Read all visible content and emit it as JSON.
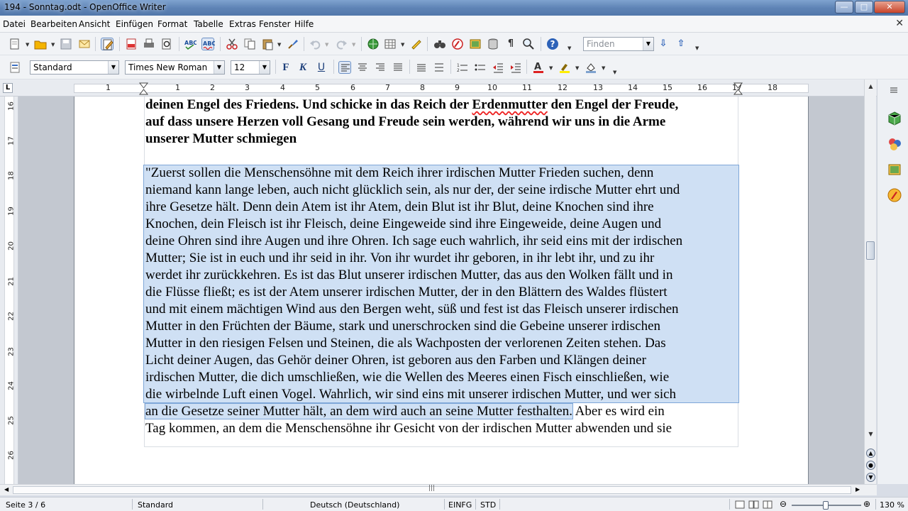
{
  "window": {
    "title": "194 - Sonntag.odt - OpenOffice Writer",
    "minimize_glyph": "—",
    "maximize_glyph": "□",
    "close_glyph": "✕"
  },
  "menubar": {
    "items": [
      "Datei",
      "Bearbeiten",
      "Ansicht",
      "Einfügen",
      "Format",
      "Tabelle",
      "Extras",
      "Fenster",
      "Hilfe"
    ],
    "doc_close": "✕"
  },
  "formatting": {
    "paragraph_style": "Standard",
    "font_name": "Times New Roman",
    "font_size": "12",
    "find_placeholder": "Finden",
    "bold": "F",
    "italic": "K",
    "underline": "U"
  },
  "ruler": {
    "corner": "L",
    "h_numbers": [
      "1",
      "1",
      "2",
      "3",
      "4",
      "5",
      "6",
      "7",
      "8",
      "9",
      "10",
      "11",
      "12",
      "13",
      "14",
      "15",
      "16",
      "17",
      "18"
    ],
    "v_numbers": [
      "16",
      "17",
      "18",
      "19",
      "20",
      "21",
      "22",
      "23",
      "24",
      "25",
      "26"
    ]
  },
  "document": {
    "heading_lines": [
      [
        "deinen Engel des Friedens. Und schicke in das Reich der ",
        "Erdenmutter",
        " den Engel der Freude,"
      ],
      [
        "auf dass unsere Herzen voll Gesang und Freude sein werden, während wir uns in die Arme",
        "",
        ""
      ],
      [
        "unserer Mutter schmiegen",
        "",
        ""
      ]
    ],
    "selected_lines": [
      "\"Zuerst sollen die Menschensöhne mit dem Reich ihrer irdischen Mutter Frieden suchen, denn",
      "niemand kann lange leben, auch nicht glücklich sein, als nur der, der seine irdische Mutter ehrt und",
      "ihre Gesetze hält. Denn dein Atem ist ihr Atem, dein Blut ist ihr Blut, deine Knochen sind ihre",
      "Knochen, dein Fleisch ist ihr Fleisch, deine Eingeweide sind ihre Eingeweide, deine Augen und",
      "deine Ohren sind ihre Augen und ihre Ohren. Ich sage euch wahrlich, ihr seid eins mit der irdischen",
      "Mutter; Sie ist in euch und ihr seid in ihr. Von ihr wurdet ihr geboren, in ihr lebt ihr, und zu ihr",
      "werdet ihr zurückkehren. Es ist das Blut unserer irdischen Mutter, das aus den Wolken fällt und in",
      "die Flüsse fließt; es ist der Atem unserer irdischen Mutter, der in den Blättern des Waldes flüstert",
      "und mit einem mächtigen Wind aus den Bergen weht, süß und fest ist das Fleisch unserer irdischen",
      "Mutter in den Früchten der Bäume, stark und unerschrocken sind die Gebeine unserer irdischen",
      "Mutter in den riesigen Felsen und Steinen, die als Wachposten der verlorenen Zeiten stehen. Das",
      "Licht deiner Augen, das Gehör deiner Ohren, ist geboren aus den Farben und Klängen deiner",
      "irdischen Mutter, die dich umschließen, wie die Wellen des Meeres einen Fisch einschließen, wie",
      "die wirbelnde Luft einen Vogel. Wahrlich, wir sind eins mit unserer irdischen Mutter, und wer sich"
    ],
    "partial_line_selected": "an die Gesetze seiner Mutter hält, an dem wird auch an seine Mutter festhalten.",
    "partial_line_rest": " Aber es wird ein",
    "last_line": "Tag kommen, an dem die Menschensöhne ihr Gesicht von der irdischen Mutter abwenden und sie"
  },
  "statusbar": {
    "page": "Seite 3 / 6",
    "style": "Standard",
    "language": "Deutsch (Deutschland)",
    "insert_mode": "EINFG",
    "selection_mode": "STD",
    "zoom": "130 %"
  },
  "colors": {
    "selection": "#cfe0f4",
    "selection_border": "#7fa7d8",
    "page": "#ffffff",
    "background": "#c3c8d0"
  }
}
